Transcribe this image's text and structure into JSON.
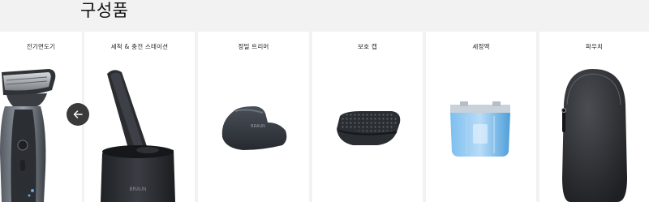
{
  "section": {
    "title": "구성품"
  },
  "products": [
    {
      "label": "전기면도기",
      "icon": "electric-shaver-icon"
    },
    {
      "label": "세척 & 충전 스테이션",
      "icon": "cleaning-station-icon"
    },
    {
      "label": "정밀 트리머",
      "icon": "precision-trimmer-icon"
    },
    {
      "label": "보호 캡",
      "icon": "protective-cap-icon"
    },
    {
      "label": "세정액",
      "icon": "cleaning-cartridge-icon"
    },
    {
      "label": "파우치",
      "icon": "pouch-icon"
    }
  ],
  "brand_mark": "BRAUN",
  "carousel": {
    "prev_icon": "arrow-left-icon"
  },
  "colors": {
    "background": "#f2f2f2",
    "card": "#ffffff",
    "accent_blue": "#5aa9e6",
    "dark": "#2e3035"
  }
}
